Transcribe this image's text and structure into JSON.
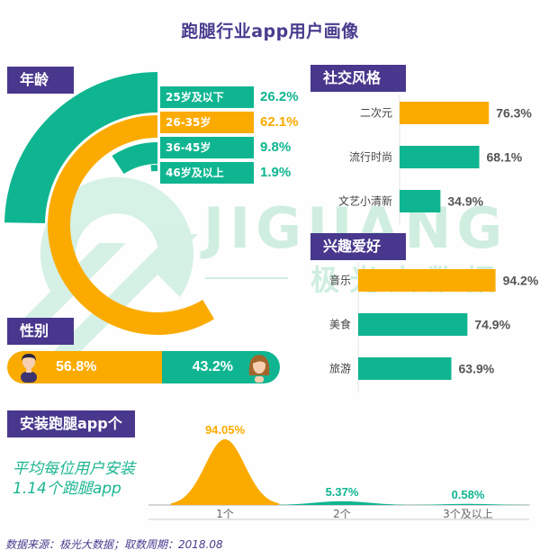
{
  "title": "跑腿行业app用户画像",
  "colors": {
    "teal": "#0fb591",
    "orange": "#fbab00",
    "purple": "#4b3a93",
    "watermark": "#cbeedd"
  },
  "watermark": {
    "latin": "JIGUANG",
    "chinese": "极 光 大 数 据"
  },
  "sections": {
    "age": "年龄",
    "gender": "性别",
    "social": "社交风格",
    "interest": "兴趣爱好",
    "install": "安装跑腿app个数"
  },
  "chart_data": [
    {
      "id": "age",
      "type": "pie",
      "title": "年龄",
      "style": "concentric-radial-bars",
      "categories": [
        "25岁及以下",
        "26-35岁",
        "36-45岁",
        "46岁及以上"
      ],
      "values": [
        26.2,
        62.1,
        9.8,
        1.9
      ],
      "value_labels": [
        "26.2%",
        "62.1%",
        "9.8%",
        "1.9%"
      ],
      "colors": [
        "#0fb591",
        "#fbab00",
        "#0fb591",
        "#0fb591"
      ]
    },
    {
      "id": "gender",
      "type": "bar",
      "title": "性别",
      "style": "stacked-horizontal",
      "categories": [
        "男",
        "女"
      ],
      "values": [
        56.8,
        43.2
      ],
      "value_labels": [
        "56.8%",
        "43.2%"
      ],
      "colors": [
        "#fbab00",
        "#0fb591"
      ]
    },
    {
      "id": "social",
      "type": "bar",
      "title": "社交风格",
      "orientation": "horizontal",
      "categories": [
        "二次元",
        "流行时尚",
        "文艺小清新"
      ],
      "values": [
        76.3,
        68.1,
        34.9
      ],
      "value_labels": [
        "76.3%",
        "68.1%",
        "34.9%"
      ],
      "colors": [
        "#fbab00",
        "#0fb591",
        "#0fb591"
      ],
      "xlim": [
        0,
        100
      ]
    },
    {
      "id": "interest",
      "type": "bar",
      "title": "兴趣爱好",
      "orientation": "horizontal",
      "categories": [
        "音乐",
        "美食",
        "旅游"
      ],
      "values": [
        94.2,
        74.9,
        63.9
      ],
      "value_labels": [
        "94.2%",
        "74.9%",
        "63.9%"
      ],
      "colors": [
        "#fbab00",
        "#0fb591",
        "#0fb591"
      ],
      "xlim": [
        0,
        100
      ]
    },
    {
      "id": "install",
      "type": "area",
      "title": "安装跑腿app个数",
      "style": "bell-peaks",
      "categories": [
        "1个",
        "2个",
        "3个及以上"
      ],
      "values": [
        94.05,
        5.37,
        0.58
      ],
      "value_labels": [
        "94.05%",
        "5.37%",
        "0.58%"
      ],
      "colors": [
        "#fbab00",
        "#0fb591",
        "#0fb591"
      ],
      "ylim": [
        0,
        100
      ]
    }
  ],
  "install_summary": [
    "平均每位用户安装",
    "1.14个跑腿app"
  ],
  "footer": "数据来源：极光大数据；取数周期：2018.08"
}
